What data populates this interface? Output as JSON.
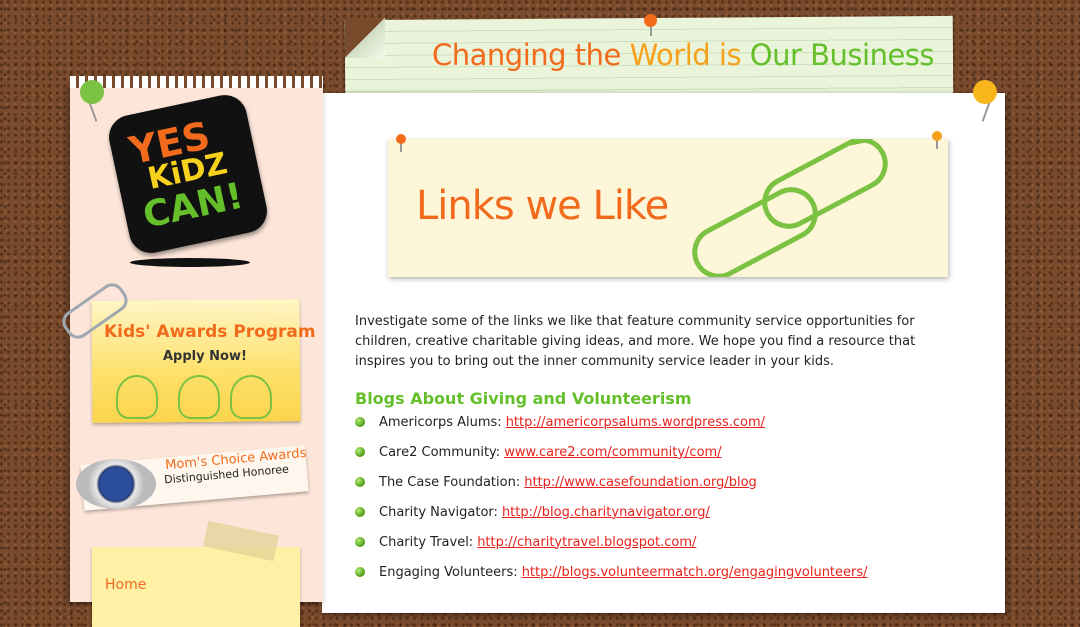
{
  "header": {
    "slogan_part1": "Changing the ",
    "slogan_part2": "World is ",
    "slogan_part3": "Our Business"
  },
  "logo": {
    "line1": "YES",
    "line2": "KiDZ",
    "line3": "CAN!"
  },
  "sidebar": {
    "awards": {
      "title": "Kids' Awards Program",
      "cta": "Apply Now!"
    },
    "moms_choice": {
      "title": "Mom's Choice Awards",
      "subtitle": "Distinguished Honoree"
    },
    "sticky_label": "Home"
  },
  "banner": {
    "title": "Links we Like"
  },
  "content": {
    "intro": "Investigate some of the links we like that feature community service opportunities for children, creative charitable giving ideas, and more. We hope you find a resource that inspires you to bring out the inner community service leader in your kids.",
    "section_title": "Blogs About Giving and Volunteerism",
    "links": [
      {
        "label": "Americorps Alums:",
        "url": "http://americorpsalums.wordpress.com/"
      },
      {
        "label": "Care2 Community:",
        "url": "www.care2.com/community/com/"
      },
      {
        "label": "The Case Foundation:",
        "url": "http://www.casefoundation.org/blog"
      },
      {
        "label": "Charity Navigator:",
        "url": "http://blog.charitynavigator.org/"
      },
      {
        "label": "Charity Travel:",
        "url": "http://charitytravel.blogspot.com/"
      },
      {
        "label": "Engaging Volunteers:",
        "url": "http://blogs.volunteermatch.org/engagingvolunteers/"
      }
    ]
  },
  "colors": {
    "orange": "#f26a1b",
    "yellow": "#f6a11c",
    "green": "#64bf2a",
    "link_red": "#e8221b",
    "corkboard": "#7a4a2c"
  }
}
